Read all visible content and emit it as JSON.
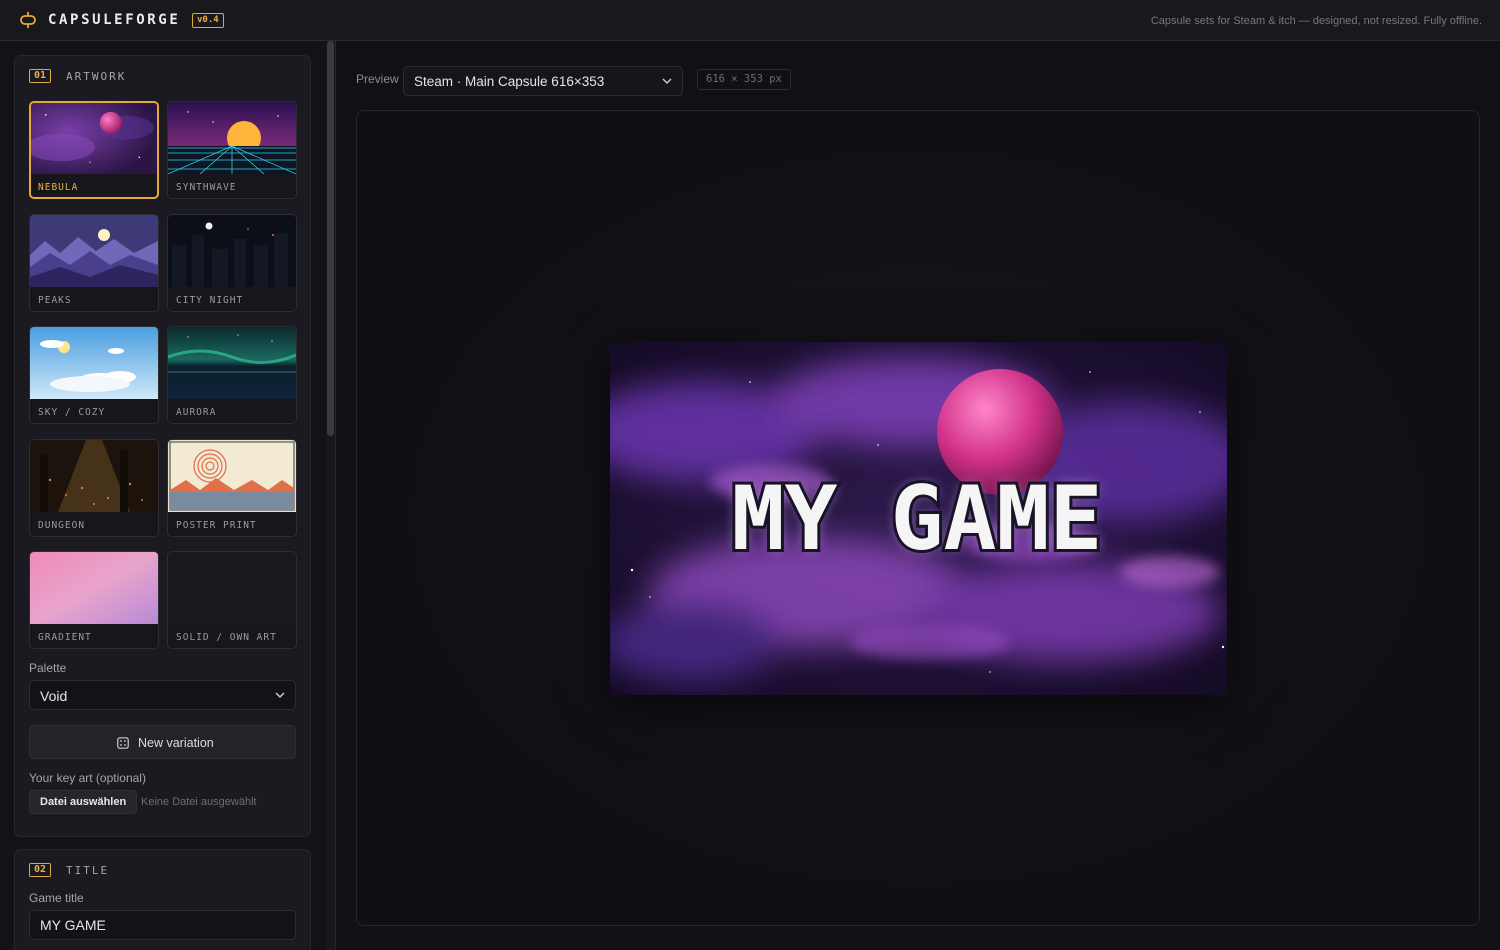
{
  "header": {
    "app_name": "CAPSULEFORGE",
    "version": "v0.4",
    "tagline": "Capsule sets for Steam & itch — designed, not resized. Fully offline."
  },
  "sidebar": {
    "artwork": {
      "number": "01",
      "label": "ARTWORK",
      "tiles": [
        {
          "label": "NEBULA",
          "selected": true
        },
        {
          "label": "SYNTHWAVE"
        },
        {
          "label": "PEAKS"
        },
        {
          "label": "CITY NIGHT"
        },
        {
          "label": "SKY / COZY"
        },
        {
          "label": "AURORA"
        },
        {
          "label": "DUNGEON"
        },
        {
          "label": "POSTER PRINT"
        },
        {
          "label": "GRADIENT"
        },
        {
          "label": "SOLID / OWN ART"
        }
      ],
      "palette_label": "Palette",
      "palette_value": "Void",
      "new_variation_label": "New variation",
      "key_art_label": "Your key art (optional)",
      "file_button": "Datei auswählen",
      "file_status": "Keine Datei ausgewählt"
    },
    "title": {
      "number": "02",
      "label": "TITLE",
      "game_title_label": "Game title",
      "game_title_value": "MY GAME"
    }
  },
  "main": {
    "preview_label": "Preview",
    "preview_value": "Steam · Main Capsule 616×353",
    "dimensions": "616 × 353 px",
    "capsule_title": "MY GAME"
  },
  "colors": {
    "accent": "#e6a83a",
    "background": "#111115",
    "panel": "#1a1a20"
  }
}
